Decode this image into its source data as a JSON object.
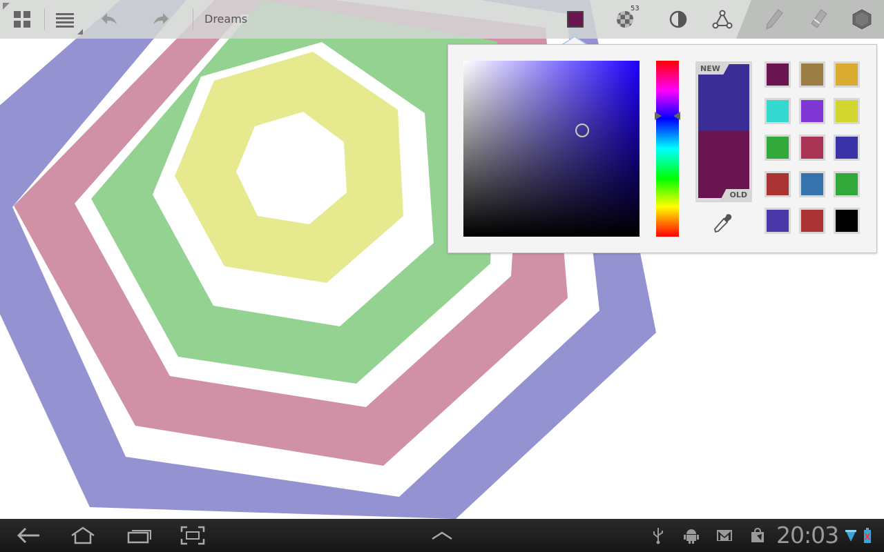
{
  "toolbar": {
    "document_title": "Dreams",
    "opacity_count": "53",
    "current_color": "#6b1550",
    "items": [
      "grid-icon",
      "menu-icon",
      "undo-icon",
      "redo-icon",
      "color-icon",
      "opacity-icon",
      "contrast-icon",
      "nodes-icon",
      "pencil-icon",
      "eraser-icon",
      "shape-icon"
    ]
  },
  "color_picker": {
    "hue_color": "#1f00ff",
    "new_label": "NEW",
    "old_label": "OLD",
    "new_color": "#3a2d96",
    "old_color": "#6b1550",
    "presets": [
      "#6b1550",
      "#9a7e44",
      "#d9ab30",
      "#33d9cf",
      "#7f37d6",
      "#d4d630",
      "#33a83a",
      "#aa3456",
      "#3a33a8",
      "#aa3333",
      "#3673ad",
      "#33a83a",
      "#4a38a8",
      "#aa3333",
      "#000000"
    ]
  },
  "canvas": {
    "rings": [
      "#9592d1",
      "#d090a6",
      "#94d292",
      "#e7e98e"
    ]
  },
  "navbar": {
    "clock": "20:03",
    "buttons": [
      "back-icon",
      "home-icon",
      "recent-apps-icon",
      "screenshot-icon",
      "up-icon"
    ],
    "status_icons": [
      "usb-icon",
      "android-icon",
      "gmail-icon",
      "store-icon",
      "wifi-icon",
      "battery-icon"
    ]
  }
}
